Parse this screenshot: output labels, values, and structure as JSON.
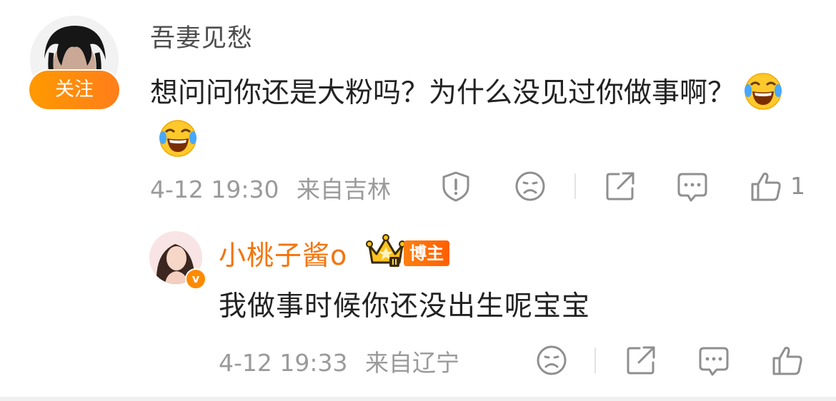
{
  "comment": {
    "username": "吾妻见愁",
    "follow_label": "关注",
    "text": "想问问你还是大粉吗？为什么没见过你做事啊？",
    "emojis": [
      "laugh-cry-emoji",
      "laugh-cry-emoji"
    ],
    "date": "4-12 19:30",
    "location": "来自吉林",
    "like_count": "1",
    "icons": [
      "report-icon",
      "dislike-face-icon",
      "share-icon",
      "reply-icon",
      "thumbs-up-icon"
    ]
  },
  "reply": {
    "username": "小桃子酱o",
    "badge_label": "博主",
    "crown_level": "II",
    "verified_mark": "v",
    "text": "我做事时候你还没出生呢宝宝",
    "date": "4-12 19:33",
    "location": "来自辽宁",
    "icons": [
      "dislike-face-icon",
      "share-icon",
      "reply-icon",
      "thumbs-up-icon"
    ]
  },
  "colors": {
    "accent_orange": "#ff8a00",
    "username_orange": "#f5730a",
    "meta_gray": "#9a9a9a",
    "text_dark": "#222222"
  }
}
